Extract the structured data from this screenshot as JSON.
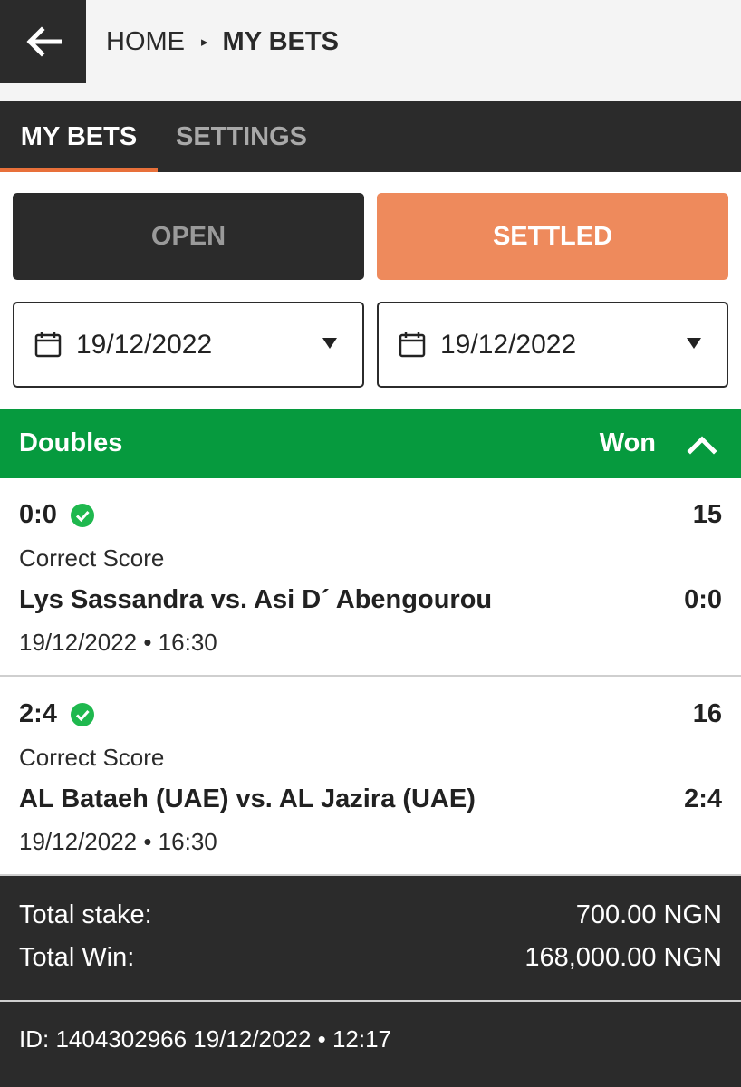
{
  "header": {
    "back_icon": "arrow-left-icon",
    "breadcrumb": {
      "home": "HOME",
      "separator": "▸",
      "current": "MY BETS"
    }
  },
  "tabs": [
    {
      "label": "MY BETS",
      "active": true
    },
    {
      "label": "SETTINGS",
      "active": false
    }
  ],
  "filters": {
    "open_label": "OPEN",
    "settled_label": "SETTLED",
    "date_from": "19/12/2022",
    "date_to": "19/12/2022"
  },
  "bet": {
    "type": "Doubles",
    "status": "Won",
    "selections": [
      {
        "pick": "0:0",
        "odds": "15",
        "market": "Correct Score",
        "match": "Lys Sassandra vs. Asi D´ Abengourou",
        "result": "0:0",
        "kickoff": "19/12/2022 • 16:30"
      },
      {
        "pick": "2:4",
        "odds": "16",
        "market": "Correct Score",
        "match": "AL Bataeh (UAE) vs. AL Jazira (UAE)",
        "result": "2:4",
        "kickoff": "19/12/2022 • 16:30"
      }
    ],
    "totals": {
      "stake_label": "Total stake:",
      "stake_value": "700.00 NGN",
      "win_label": "Total Win:",
      "win_value": "168,000.00 NGN"
    },
    "footer": "ID: 1404302966  19/12/2022 • 12:17"
  },
  "colors": {
    "dark": "#2b2b2b",
    "accent": "#e8703a",
    "settled": "#ee8a5c",
    "won": "#069a3e",
    "check": "#1fb84e"
  }
}
